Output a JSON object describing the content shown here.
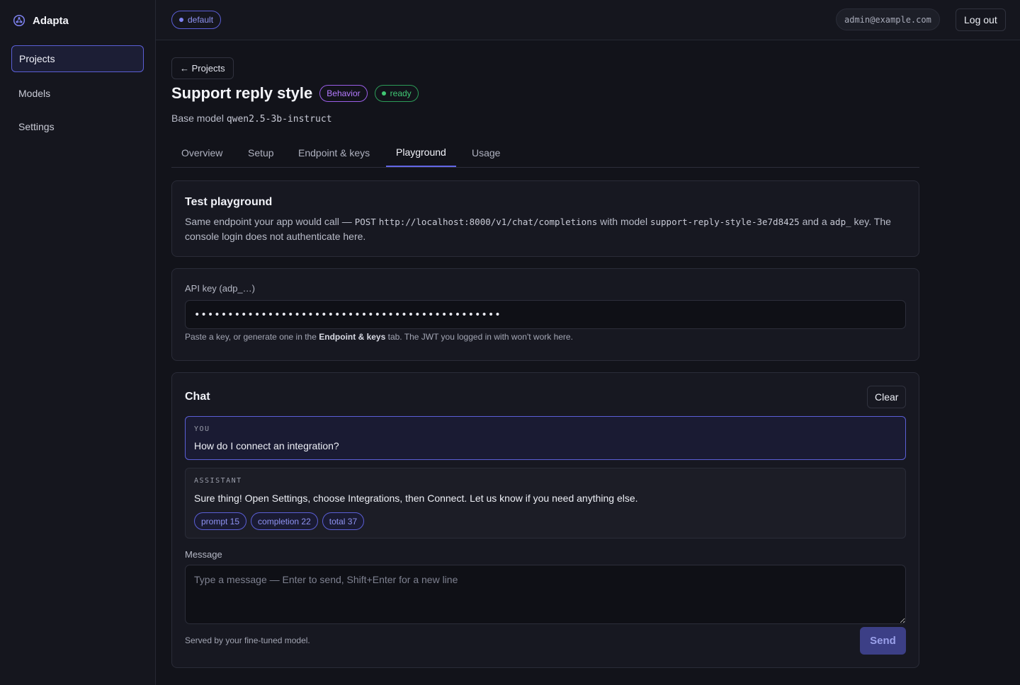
{
  "app": {
    "name": "Adapta"
  },
  "sidebar": {
    "items": [
      {
        "label": "Projects",
        "active": true
      },
      {
        "label": "Models",
        "active": false
      },
      {
        "label": "Settings",
        "active": false
      }
    ]
  },
  "topbar": {
    "workspace": "default",
    "user_email": "admin@example.com",
    "logout_label": "Log out"
  },
  "project": {
    "back_label": "← Projects",
    "title": "Support reply style",
    "type_badge": "Behavior",
    "status_badge": "ready",
    "base_model_label": "Base model",
    "base_model": "qwen2.5-3b-instruct"
  },
  "tabs": [
    {
      "label": "Overview",
      "active": false
    },
    {
      "label": "Setup",
      "active": false
    },
    {
      "label": "Endpoint & keys",
      "active": false
    },
    {
      "label": "Playground",
      "active": true
    },
    {
      "label": "Usage",
      "active": false
    }
  ],
  "playground": {
    "title": "Test playground",
    "desc_prefix": "Same endpoint your app would call —",
    "method": "POST",
    "url": "http://localhost:8000/v1/chat/completions",
    "desc_with_model": "with model",
    "model_id": "support-reply-style-3e7d8425",
    "desc_and_a": "and a",
    "key_prefix": "adp_",
    "desc_suffix": "key. The console login does not authenticate here."
  },
  "api_key": {
    "label": "API key (adp_…)",
    "value": "••••••••••••••••••••••••••••••••••••••••••••••",
    "hint_prefix": "Paste a key, or generate one in the",
    "hint_link": "Endpoint & keys",
    "hint_suffix": "tab. The JWT you logged in with won't work here."
  },
  "chat": {
    "title": "Chat",
    "clear_label": "Clear",
    "messages": [
      {
        "role": "YOU",
        "text": "How do I connect an integration?"
      },
      {
        "role": "ASSISTANT",
        "text": "Sure thing! Open Settings, choose Integrations, then Connect. Let us know if you need anything else."
      }
    ],
    "tokens": [
      {
        "label": "prompt 15"
      },
      {
        "label": "completion 22"
      },
      {
        "label": "total 37"
      }
    ],
    "message_label": "Message",
    "message_placeholder": "Type a message — Enter to send, Shift+Enter for a new line",
    "served_by": "Served by your fine-tuned model.",
    "send_label": "Send"
  },
  "colors": {
    "accent": "#5b5fd6",
    "behavior_badge": "#9b5ee8",
    "ready_badge": "#40c774",
    "background": "#12131a"
  }
}
